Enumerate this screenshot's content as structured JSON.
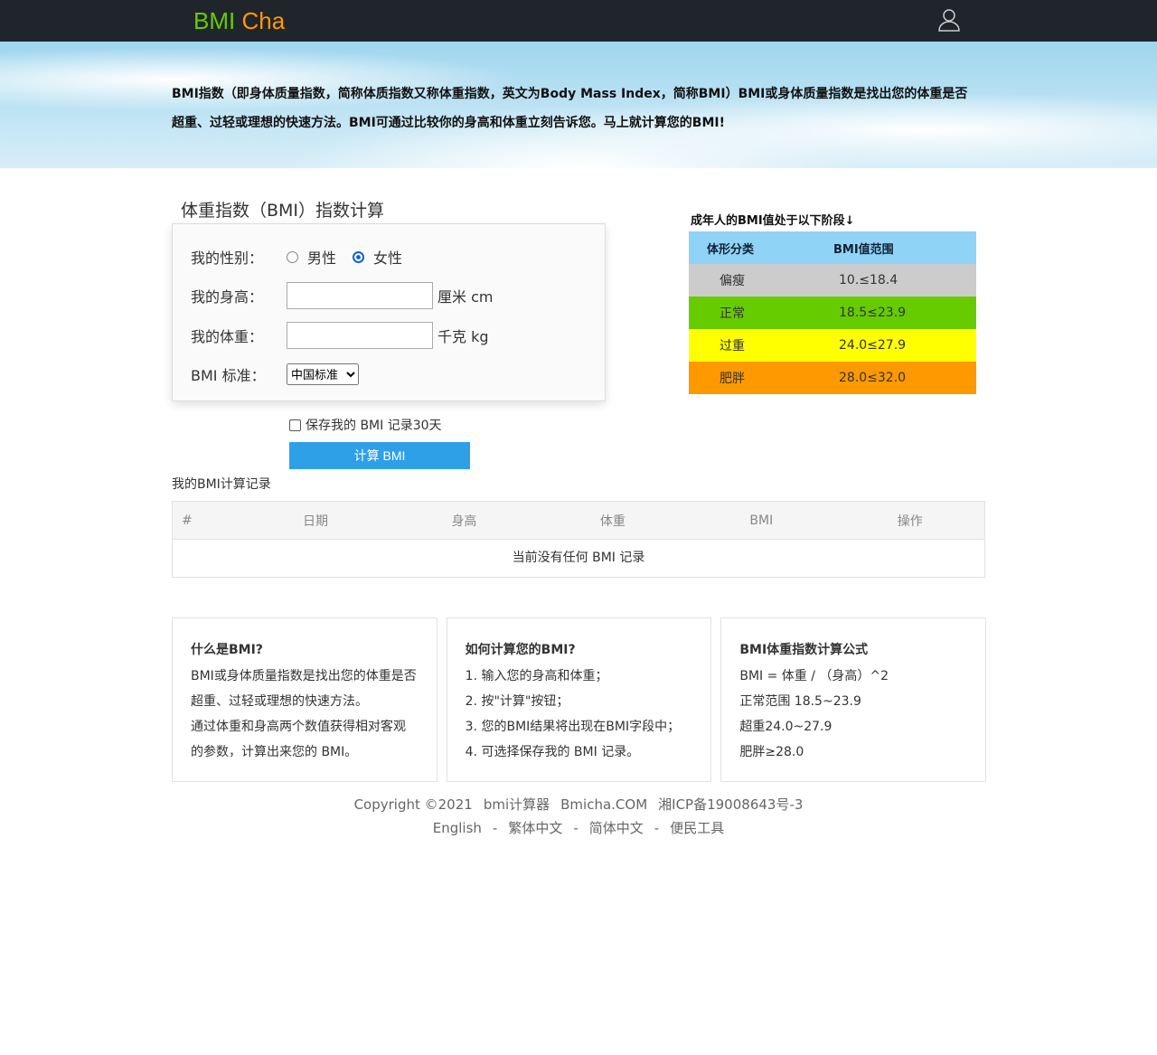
{
  "nav": {
    "logo_a": "BMI",
    "logo_b": "Cha"
  },
  "banner": {
    "text": "BMI指数（即身体质量指数，简称体质指数又称体重指数，英文为Body Mass Index，简称BMI）BMI或身体质量指数是找出您的体重是否超重、过轻或理想的快速方法。BMI可通过比较你的身高和体重立刻告诉您。马上就计算您的BMI!"
  },
  "form": {
    "title": "体重指数（BMI）指数计算",
    "gender_label": "我的性别：",
    "male": "男性",
    "female": "女性",
    "height_label": "我的身高：",
    "height_unit": "厘米 cm",
    "height_value": "",
    "weight_label": "我的体重：",
    "weight_unit": "千克 kg",
    "weight_value": "",
    "standard_label": "BMI 标准：",
    "standard_value": "中国标准",
    "save_label": "保存我的 BMI 记录30天",
    "calc_label": "计算 BMI"
  },
  "ranges": {
    "title": "成年人的BMI值处于以下阶段↓",
    "headers": [
      "体形分类",
      "BMI值范围"
    ],
    "rows": [
      {
        "name": "偏瘦",
        "range": "10.≤18.4",
        "color": "#cccccc"
      },
      {
        "name": "正常",
        "range": "18.5≤23.9",
        "color": "#66cc00"
      },
      {
        "name": "过重",
        "range": "24.0≤27.9",
        "color": "#ffff00"
      },
      {
        "name": "肥胖",
        "range": "28.0≤32.0",
        "color": "#ff9900"
      }
    ]
  },
  "records": {
    "title": "我的BMI计算记录",
    "headers": [
      "#",
      "日期",
      "身高",
      "体重",
      "BMI",
      "操作"
    ],
    "empty": "当前没有任何 BMI 记录"
  },
  "cards": [
    {
      "title": "什么是BMI?",
      "lines": [
        "BMI或身体质量指数是找出您的体重是否",
        "超重、过轻或理想的快速方法。",
        "通过体重和身高两个数值获得相对客观",
        "的参数，计算出来您的 BMI。"
      ]
    },
    {
      "title": "如何计算您的BMI?",
      "lines": [
        "1. 输入您的身高和体重；",
        "2. 按\"计算\"按钮；",
        "3. 您的BMI结果将出现在BMI字段中；",
        "4. 可选择保存我的 BMI 记录。"
      ]
    },
    {
      "title": "BMI体重指数计算公式",
      "lines": [
        "BMI = 体重 / （身高）^2",
        "正常范围 18.5~23.9",
        "超重24.0~27.9",
        "肥胖≥28.0"
      ]
    }
  ],
  "footer": {
    "line1": [
      "Copyright ©2021",
      "bmi计算器",
      "Bmicha.COM",
      "湘ICP备19008643号-3"
    ],
    "links": [
      "English",
      "繁体中文",
      "简体中文",
      "便民工具"
    ],
    "sep": "-"
  }
}
